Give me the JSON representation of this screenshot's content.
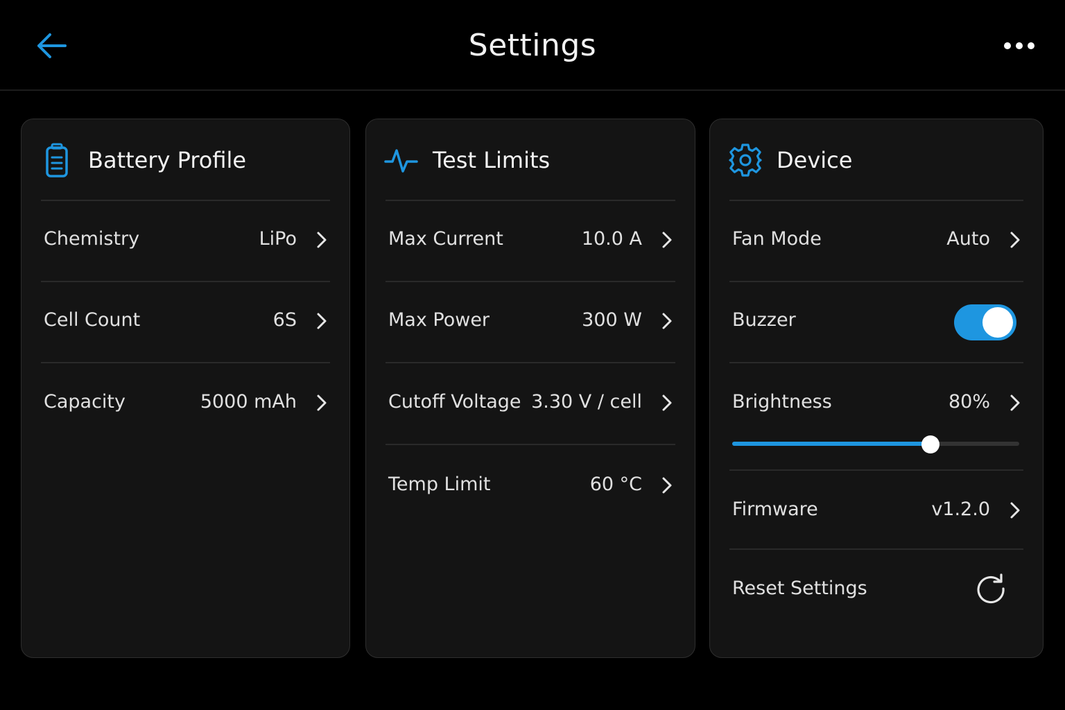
{
  "header": {
    "title": "Settings",
    "back_icon": "arrow-left-icon",
    "more_icon": "more-horizontal-icon"
  },
  "colors": {
    "accent": "#1e96e0",
    "background": "#000000",
    "card": "#141414",
    "text": "#e6e6e6"
  },
  "battery_profile": {
    "title": "Battery Profile",
    "icon": "battery-icon",
    "rows": [
      {
        "label": "Chemistry",
        "value": "LiPo"
      },
      {
        "label": "Cell Count",
        "value": "6S"
      },
      {
        "label": "Capacity",
        "value": "5000 mAh"
      }
    ]
  },
  "test_limits": {
    "title": "Test Limits",
    "icon": "activity-icon",
    "rows": [
      {
        "label": "Max Current",
        "value": "10.0 A"
      },
      {
        "label": "Max Power",
        "value": "300 W"
      },
      {
        "label": "Cutoff Voltage",
        "value": "3.30 V / cell"
      },
      {
        "label": "Temp Limit",
        "value": "60 °C"
      }
    ]
  },
  "device": {
    "title": "Device",
    "icon": "gear-icon",
    "fan_mode": {
      "label": "Fan Mode",
      "value": "Auto"
    },
    "buzzer": {
      "label": "Buzzer",
      "enabled": true
    },
    "brightness": {
      "label": "Brightness",
      "value": "80%",
      "level": 0.69
    },
    "firmware": {
      "label": "Firmware",
      "value": "v1.2.0"
    },
    "reset": {
      "label": "Reset Settings",
      "icon": "refresh-icon"
    }
  }
}
